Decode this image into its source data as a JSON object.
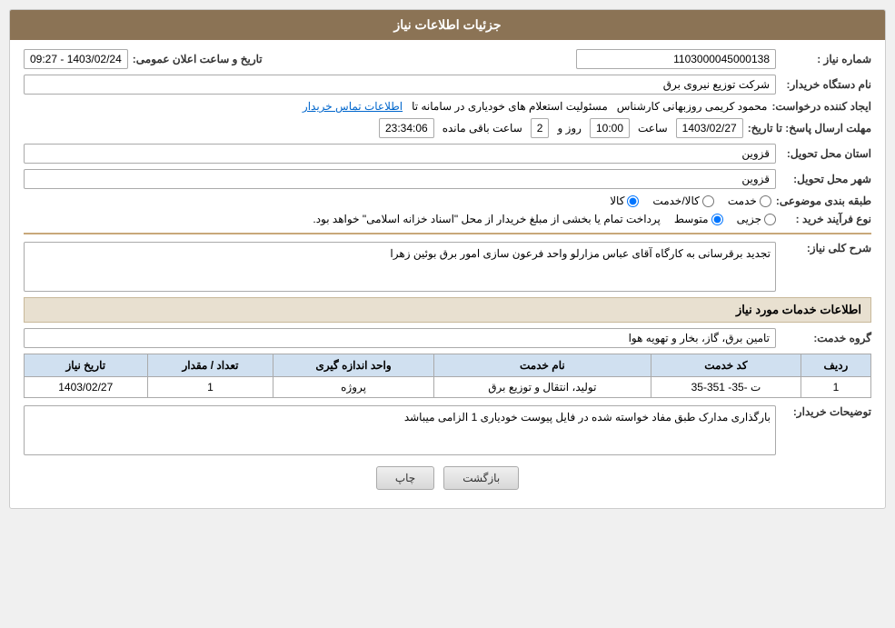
{
  "header": {
    "title": "جزئیات اطلاعات نیاز"
  },
  "fields": {
    "need_number_label": "شماره نیاز :",
    "need_number_value": "1103000045000138",
    "buyer_org_label": "نام دستگاه خریدار:",
    "buyer_org_value": "شرکت توزیع نیروی برق",
    "creator_label": "ایجاد کننده درخواست:",
    "creator_name": "محمود کریمی روزبهانی کارشناس",
    "creator_role": "مسئولیت استعلام های خودیاری در سامانه تا",
    "creator_link": "اطلاعات تماس خریدار",
    "announce_date_label": "تاریخ و ساعت اعلان عمومی:",
    "announce_date_value": "1403/02/24 - 09:27",
    "response_date_label": "مهلت ارسال پاسخ: تا تاریخ:",
    "response_date_value": "1403/02/27",
    "response_time_value": "10:00",
    "response_days": "2",
    "response_time_remaining": "23:34:06",
    "province_label": "استان محل تحویل:",
    "province_value": "قزوین",
    "city_label": "شهر محل تحویل:",
    "city_value": "قزوین",
    "category_label": "طبقه بندی موضوعی:",
    "category_options": [
      "خدمت",
      "کالا/خدمت",
      "کالا"
    ],
    "category_selected": "کالا",
    "process_label": "نوع فرآیند خرید :",
    "process_options": [
      "جزیی",
      "متوسط",
      "پرداخت تمام یا بخشی از مبلغ خریدار از محل \"اسناد خزانه اسلامی\" خواهد بود."
    ],
    "process_selected": "متوسط",
    "description_label": "شرح کلی نیاز:",
    "description_value": "تجدید برقرسانی به کارگاه آقای عباس مزارلو واحد فرعون سازی امور برق بوئین زهرا",
    "services_section_title": "اطلاعات خدمات مورد نیاز",
    "service_group_label": "گروه خدمت:",
    "service_group_value": "تامین برق، گاز، بخار و تهویه هوا",
    "table_headers": [
      "ردیف",
      "کد خدمت",
      "نام خدمت",
      "واحد اندازه گیری",
      "تعداد / مقدار",
      "تاریخ نیاز"
    ],
    "table_rows": [
      {
        "row": "1",
        "code": "ت -35- 351-35",
        "name": "تولید، انتقال و توزیع برق",
        "unit": "پروژه",
        "quantity": "1",
        "date": "1403/02/27"
      }
    ],
    "buyer_notes_label": "توضیحات خریدار:",
    "buyer_notes_value": "بارگذاری مدارک طبق مفاد خواسته شده در فایل پیوست خودیاری 1 الزامی میباشد",
    "btn_print": "چاپ",
    "btn_back": "بازگشت",
    "time_label": "ساعت",
    "days_label": "روز و",
    "remaining_label": "ساعت باقی مانده"
  },
  "icons": {
    "radio_selected": "●",
    "radio_empty": "○"
  }
}
